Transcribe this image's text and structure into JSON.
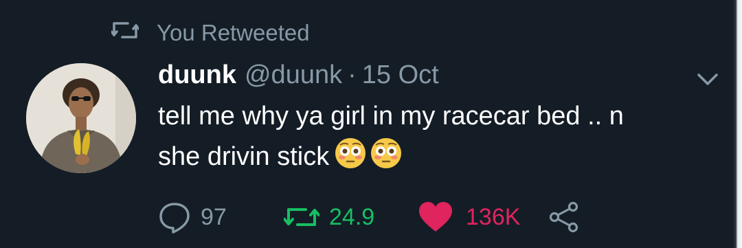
{
  "retweet_context": {
    "text": "You Retweeted",
    "icon": "retweet-icon"
  },
  "tweet": {
    "display_name": "duunk",
    "handle": "@duunk",
    "separator": "·",
    "timestamp": "15 Oct",
    "text_line_1": "tell me why ya girl in my racecar bed .. n",
    "text_line_2": "she drivin stick",
    "emojis": [
      "flushed-face-emoji",
      "flushed-face-emoji"
    ]
  },
  "actions": {
    "reply": {
      "icon": "reply-icon",
      "count": "97"
    },
    "retweet": {
      "icon": "retweet-icon",
      "count": "24.9",
      "active_color": "#17bf63"
    },
    "like": {
      "icon": "heart-icon",
      "count": "136K",
      "active_color": "#e0245e"
    },
    "share": {
      "icon": "share-icon"
    }
  },
  "colors": {
    "background": "#141d26",
    "secondary_text": "#8899a6",
    "primary_text": "#ffffff",
    "retweet_green": "#17bf63",
    "like_pink": "#e0245e"
  }
}
